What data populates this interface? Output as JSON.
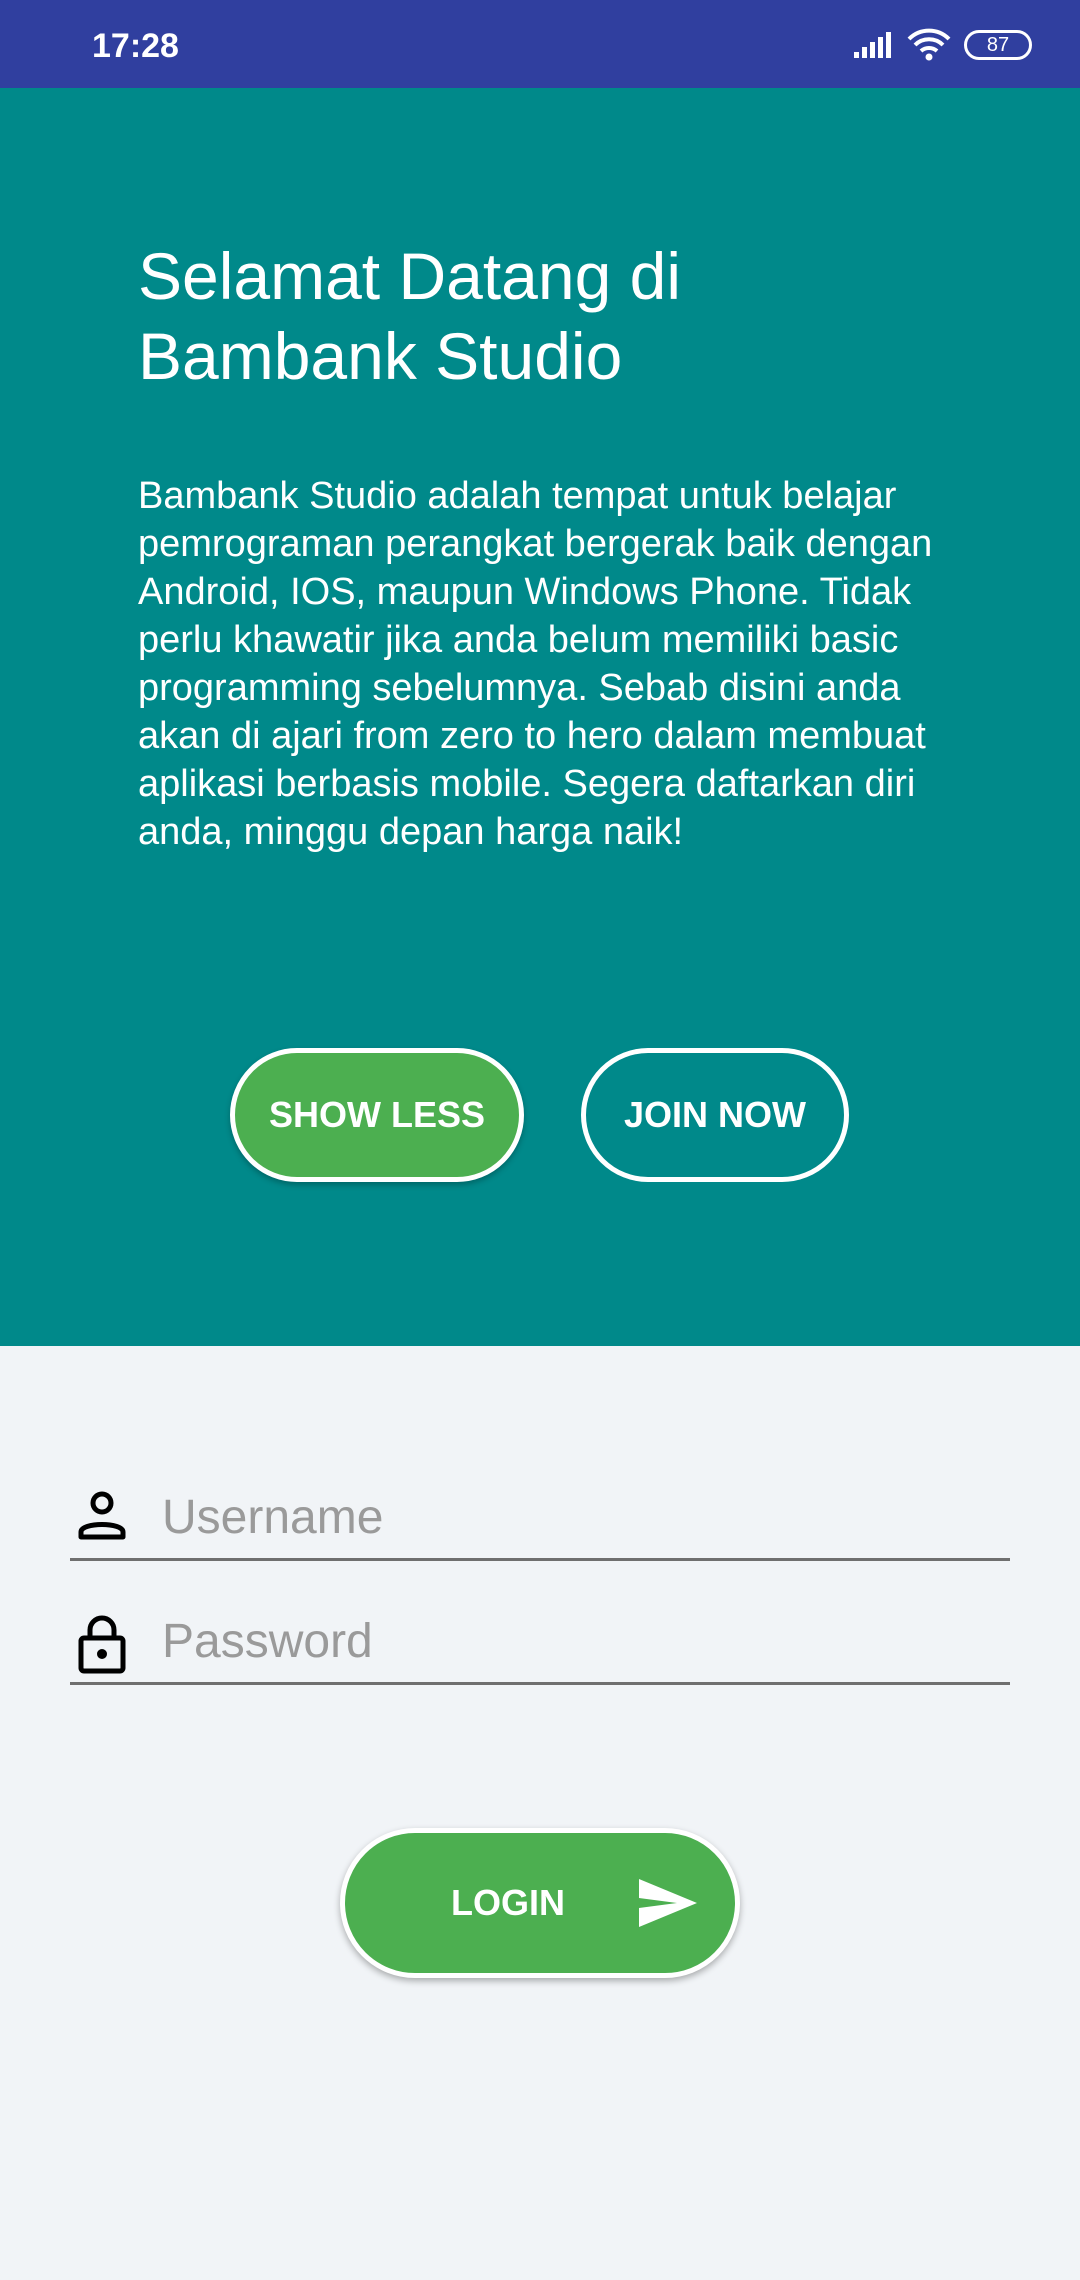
{
  "status_bar": {
    "time": "17:28",
    "battery": "87",
    "icons": [
      "signal-icon",
      "wifi-icon",
      "battery-icon"
    ]
  },
  "hero": {
    "title": "Selamat Datang di Bambank Studio",
    "body": "Bambank Studio adalah tempat untuk belajar pemrograman perangkat bergerak baik dengan Android, IOS, maupun Windows Phone. Tidak perlu khawatir jika anda belum memiliki basic programming sebelumnya. Sebab disini anda akan di ajari from zero to hero dalam membuat aplikasi berbasis mobile. Segera daftarkan diri anda, minggu depan harga naik!",
    "show_less_label": "SHOW LESS",
    "join_now_label": "JOIN NOW"
  },
  "form": {
    "username": {
      "placeholder": "Username",
      "value": "",
      "icon": "person-icon"
    },
    "password": {
      "placeholder": "Password",
      "value": "",
      "icon": "lock-icon"
    },
    "login_label": "LOGIN",
    "login_icon": "send-icon"
  },
  "colors": {
    "status_bar": "#303f9f",
    "hero_background": "#00898a",
    "button_green": "#4caf50",
    "page_background": "#f1f4f7"
  }
}
